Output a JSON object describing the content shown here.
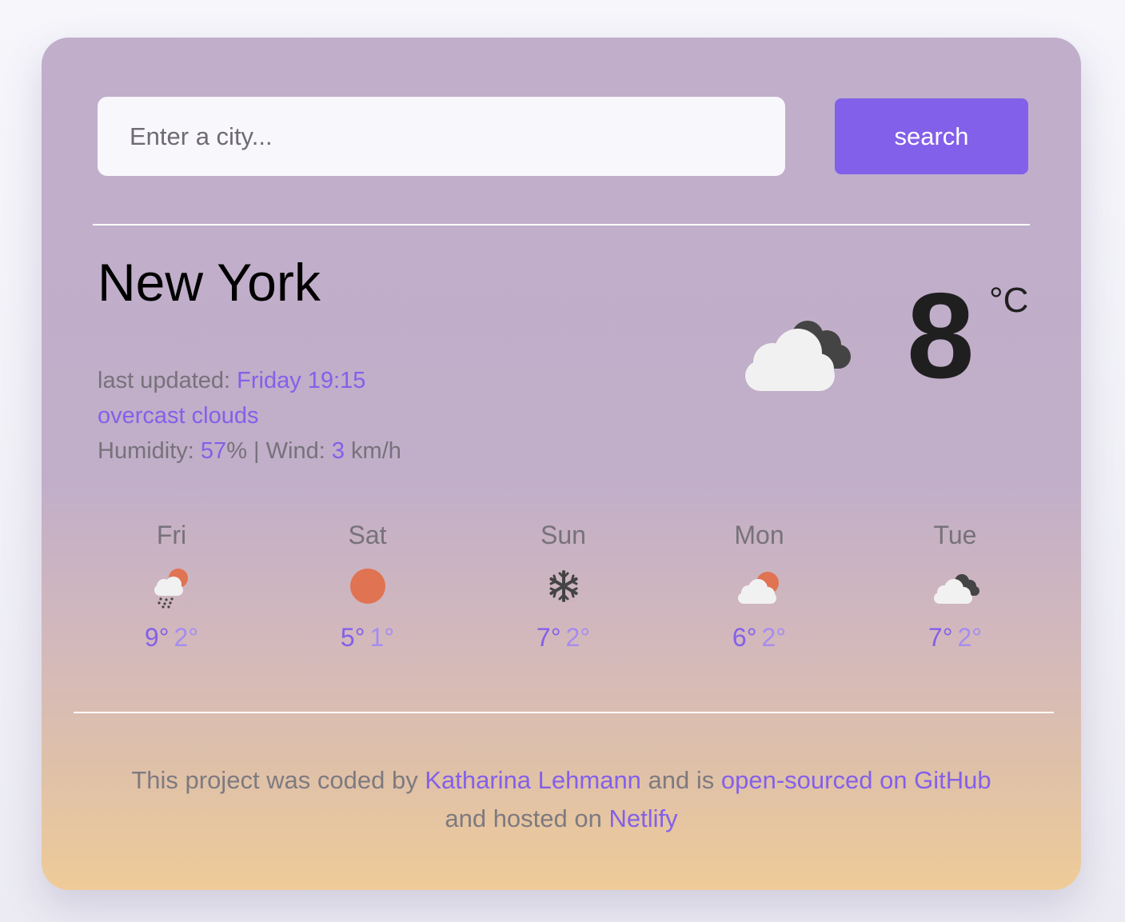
{
  "search": {
    "placeholder": "Enter a city...",
    "button_label": "search"
  },
  "current": {
    "city": "New York",
    "updated_label": "last updated:",
    "updated_value": "Friday 19:15",
    "description": "overcast clouds",
    "humidity_label": "Humidity:",
    "humidity_value": "57",
    "humidity_unit": "%",
    "separator": " | ",
    "wind_label": "Wind:",
    "wind_value": "3",
    "wind_unit": "km/h",
    "temperature": "8",
    "unit": "°C",
    "icon": "broken-clouds-icon"
  },
  "forecast": [
    {
      "day": "Fri",
      "max": "9°",
      "min": "2°",
      "icon": "rain-sun-icon"
    },
    {
      "day": "Sat",
      "max": "5°",
      "min": "1°",
      "icon": "sun-icon"
    },
    {
      "day": "Sun",
      "max": "7°",
      "min": "2°",
      "icon": "snowflake-icon"
    },
    {
      "day": "Mon",
      "max": "6°",
      "min": "2°",
      "icon": "cloud-sun-icon"
    },
    {
      "day": "Tue",
      "max": "7°",
      "min": "2°",
      "icon": "dark-clouds-icon"
    }
  ],
  "footer": {
    "text1": "This project was coded by ",
    "author": "Katharina Lehmann",
    "text2": " and is ",
    "github": "open-sourced on GitHub",
    "text3": "and hosted on ",
    "netlify": "Netlify"
  },
  "colors": {
    "accent": "#8360e9",
    "accent_light": "#a58cf0",
    "muted_text": "#77727a",
    "sun": "#e07352",
    "cloud_light": "#f1f1f1",
    "cloud_dark": "#444444"
  }
}
